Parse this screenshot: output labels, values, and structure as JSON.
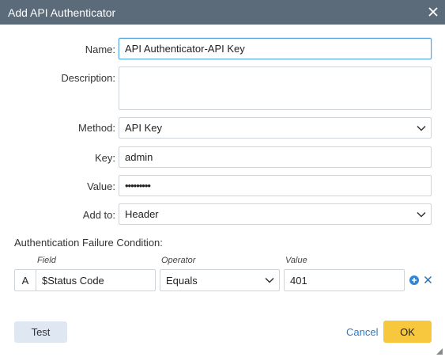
{
  "dialog": {
    "title": "Add API Authenticator"
  },
  "form": {
    "name_label": "Name:",
    "name_value": "API Authenticator-API Key",
    "description_label": "Description:",
    "description_value": "",
    "method_label": "Method:",
    "method_value": "API Key",
    "key_label": "Key:",
    "key_value": "admin",
    "value_label": "Value:",
    "value_masked": "•••••••••",
    "addto_label": "Add to:",
    "addto_value": "Header"
  },
  "failure": {
    "section_label": "Authentication Failure Condition:",
    "columns": {
      "field": "Field",
      "operator": "Operator",
      "value": "Value"
    },
    "row": {
      "letter": "A",
      "field": "$Status Code",
      "operator": "Equals",
      "value": "401"
    }
  },
  "buttons": {
    "test": "Test",
    "cancel": "Cancel",
    "ok": "OK"
  },
  "icons": [
    "close-icon",
    "chevron-down-icon",
    "add-circle-icon",
    "remove-x-icon",
    "resize-grip-icon"
  ],
  "colors": {
    "titlebar": "#5b6b7a",
    "ok_button": "#f7c83d",
    "test_button": "#dfe8f2",
    "link": "#2d7ac0",
    "add_icon": "#2f86d6"
  }
}
